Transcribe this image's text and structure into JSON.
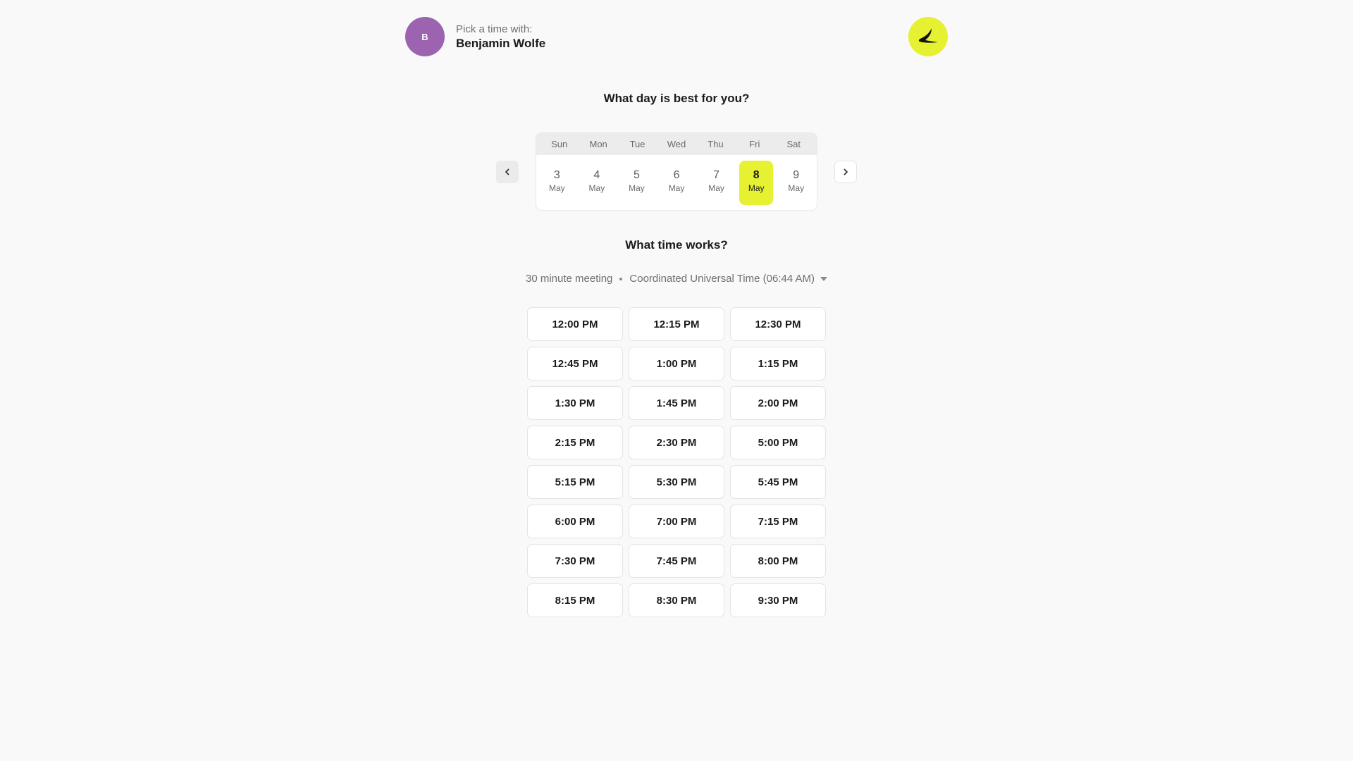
{
  "header": {
    "avatar_initial": "B",
    "subtitle": "Pick a time with:",
    "host_name": "Benjamin Wolfe",
    "brand_color": "#e6f132",
    "avatar_color": "#9b63b0"
  },
  "day_section": {
    "heading": "What day is best for you?",
    "prev_icon": "chevron-left-icon",
    "next_icon": "chevron-right-icon",
    "weekdays": [
      "Sun",
      "Mon",
      "Tue",
      "Wed",
      "Thu",
      "Fri",
      "Sat"
    ],
    "dates": [
      {
        "day": "3",
        "month": "May",
        "selected": false
      },
      {
        "day": "4",
        "month": "May",
        "selected": false
      },
      {
        "day": "5",
        "month": "May",
        "selected": false
      },
      {
        "day": "6",
        "month": "May",
        "selected": false
      },
      {
        "day": "7",
        "month": "May",
        "selected": false
      },
      {
        "day": "8",
        "month": "May",
        "selected": true
      },
      {
        "day": "9",
        "month": "May",
        "selected": false
      }
    ]
  },
  "time_section": {
    "heading": "What time works?",
    "meeting_length": "30 minute meeting",
    "timezone": "Coordinated Universal Time (06:44 AM)",
    "slots": [
      "12:00 PM",
      "12:15 PM",
      "12:30 PM",
      "12:45 PM",
      "1:00 PM",
      "1:15 PM",
      "1:30 PM",
      "1:45 PM",
      "2:00 PM",
      "2:15 PM",
      "2:30 PM",
      "5:00 PM",
      "5:15 PM",
      "5:30 PM",
      "5:45 PM",
      "6:00 PM",
      "7:00 PM",
      "7:15 PM",
      "7:30 PM",
      "7:45 PM",
      "8:00 PM",
      "8:15 PM",
      "8:30 PM",
      "9:30 PM"
    ]
  }
}
